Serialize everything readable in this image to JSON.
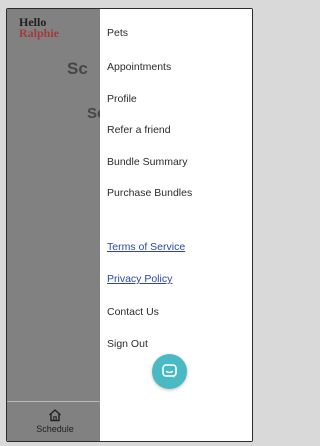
{
  "brand": {
    "logo_line1": "Hello",
    "logo_line2": "Ralphie"
  },
  "background_page": {
    "heading1": "Sc",
    "heading2": "Se"
  },
  "menu": {
    "items": [
      {
        "label": "Pets"
      },
      {
        "label": "Appointments"
      },
      {
        "label": "Profile"
      },
      {
        "label": "Refer a friend"
      },
      {
        "label": "Bundle Summary"
      },
      {
        "label": "Purchase Bundles"
      }
    ],
    "links": [
      {
        "label": "Terms of Service"
      },
      {
        "label": "Privacy Policy"
      }
    ],
    "bottom_items": [
      {
        "label": "Contact Us"
      },
      {
        "label": "Sign Out"
      }
    ]
  },
  "bottom_nav": {
    "schedule_label": "Schedule",
    "schedule_icon": "home-icon"
  },
  "chat": {
    "icon": "chat-bubble-icon",
    "color": "#49b9c4"
  },
  "colors": {
    "link": "#2b46a8",
    "logo_accent": "#a33b3b",
    "scrim": "#505050"
  }
}
